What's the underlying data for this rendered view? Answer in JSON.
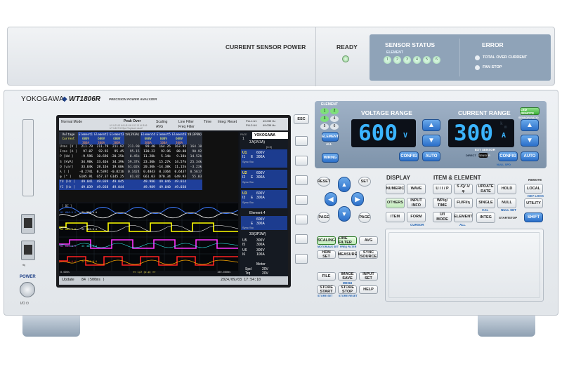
{
  "sensor_unit": {
    "current_sensor_power": "CURRENT SENSOR POWER",
    "ready": "READY",
    "sensor_status": "SENSOR STATUS",
    "element": "ELEMENT",
    "element_numbers": [
      "1",
      "2",
      "3",
      "4",
      "5",
      "6"
    ],
    "error": "ERROR",
    "total_over_current": "TOTAL OVER CURRENT",
    "fan_stop": "FAN STOP"
  },
  "branding": {
    "maker": "YOKOGAWA",
    "model": "WT1806R",
    "subtitle": "PRECISION POWER ANALYZER"
  },
  "power": {
    "label": "POWER"
  },
  "screen": {
    "mode": "Normal Mode",
    "peak_over": "Peak Over",
    "peak_rows": [
      "U1 U2 U3 U4 U5 U6 I1 I2 I3 I4 I5 I6",
      "U7 U8 I7 I8 Spd Trq Aux1 Aux2"
    ],
    "scaling": "Scaling",
    "avg": "AVG",
    "line_filter": "Line Filter",
    "freq_filter": "Freq Filter",
    "time": "Time",
    "integ": "Integ: Reset",
    "pll1": "PLL1:U1",
    "pll1_val": "49.039 Hz",
    "pll2": "PLL2:U4",
    "pll2_val": "49.039 Hz",
    "page": "PAGE",
    "page_num": "1",
    "brand": "YOKOGAWA",
    "header_row1": [
      "Voltage",
      "Element1",
      "Element2",
      "Element3",
      "ΣA(3V3A)",
      "Element4",
      "Element5",
      "Element6",
      "ΣB(3P3W)"
    ],
    "header_row2": [
      "Current",
      "600V",
      "600V",
      "600V",
      "",
      "600V",
      "600V",
      "600V",
      ""
    ],
    "header_row3": [
      "",
      "300A",
      "300A",
      "300A",
      "",
      "300A",
      "100A",
      "300A",
      ""
    ],
    "rows": [
      {
        "label": "Urms [V ]",
        "vals": [
          "211.79",
          "211.79",
          "211.92",
          "211.90",
          "99.40",
          "164.26",
          "163.95",
          "164.10"
        ]
      },
      {
        "label": "Irms [A ]",
        "vals": [
          "97.07",
          "92.93",
          "95.45",
          "95.15",
          "130.22",
          "92.96",
          "88.88",
          "90.92"
        ]
      },
      {
        "label": "P    [kW ]",
        "vals": [
          "-9.596",
          "10.696",
          "-20.25k",
          "0.45k",
          "11.28k",
          "5.14k",
          "9.38k",
          "14.52k"
        ]
      },
      {
        "label": "S    [kVA]",
        "vals": [
          "34.98k",
          "33.46k",
          "34.39k",
          "59.37k",
          "23.30k",
          "15.27k",
          "14.57k",
          "25.34k"
        ]
      },
      {
        "label": "Q    [var]",
        "vals": [
          "33.64k",
          "28.16k",
          "19.60k",
          "61.02k",
          "20.30k",
          "-14.38k",
          "11.15k",
          "-3.23k"
        ]
      },
      {
        "label": "λ    [  ]",
        "vals": [
          "-0.2741",
          "0.5392",
          "-0.8216",
          "0.1424",
          "0.4843",
          "0.3364",
          "0.6437",
          "0.5617"
        ]
      },
      {
        "label": "φ    [°  ]",
        "vals": [
          "G105.91",
          "G57.37",
          "G145.25",
          "81.82",
          "G61.03",
          "D70.34",
          "G49.93",
          "55.83"
        ]
      },
      {
        "label": "fU   [Hz ]",
        "vals": [
          "49.041",
          "49.039",
          "49.045",
          "",
          "49.986",
          "49.046",
          "49.014",
          ""
        ]
      },
      {
        "label": "fI   [Hz ]",
        "vals": [
          "49.039",
          "49.038",
          "49.044",
          "",
          "49.989",
          "49.040",
          "49.038",
          ""
        ]
      }
    ],
    "wave_scale_top": "[  DC  ]",
    "wave_labels": [
      {
        "t": "U1",
        "v": "600.0 V"
      },
      {
        "t": "I1",
        "v": "300.0 A"
      },
      {
        "t": "U2",
        "v": "600.0 V"
      },
      {
        "t": "I2",
        "v": "300.0 A"
      },
      {
        "t": "U3",
        "v": "600.0 V"
      },
      {
        "t": "I3",
        "v": "300.0 A"
      },
      {
        "t": "U4",
        "v": "600.0 V"
      },
      {
        "t": "I4",
        "v": "300.0 A"
      }
    ],
    "time_start": "0.000s",
    "time_end": "100.000ms",
    "time_div": "<< 1/2 (p-p) >>",
    "update": "Update",
    "update_count": "84 (500ms )",
    "datetime": "2024/09/03 17:54:10",
    "side": {
      "sigA": "ΣA(3V3A)",
      "sigA_sub": "[3:3]",
      "u1": "U1",
      "u1v": "600V",
      "i1": "I1",
      "i1v": "300A",
      "e1": "E",
      "u2": "U2",
      "u2v": "600V",
      "i2": "I2",
      "i2v": "300A",
      "u3": "U3",
      "u3v": "600V",
      "i3": "I3",
      "i3v": "300A",
      "sync": "Sync Src",
      "el4": "Element 4",
      "u4v": "600V",
      "i4v": "300A",
      "sigB": "ΣB(3P3W)",
      "u5": "U5",
      "u5v": "300V",
      "i5": "I5",
      "i5v": "300A",
      "u6": "U6",
      "u6v": "300V",
      "i6": "I6",
      "i6v": "100A",
      "motor": "Motor",
      "spd": "Spd",
      "spdv": "20V",
      "trq": "Trq",
      "trqv": "20V"
    }
  },
  "esc": "ESC",
  "range": {
    "element": "ELEMENT",
    "element_nums": [
      "1",
      "2",
      "3",
      "4",
      "5",
      "6"
    ],
    "element_btn": "ELEMENT",
    "all": "ALL",
    "wiring": "WIRING",
    "voltage_title": "VOLTAGE RANGE",
    "voltage_value": "600",
    "voltage_unit": "V",
    "current_title": "CURRENT RANGE",
    "current_value": "300",
    "current_unit_k": "k",
    "current_unit_m": "m",
    "current_unit": "A",
    "config": "CONFIG",
    "auto": "AUTO",
    "ext_sensor": "EXT SENSOR",
    "direct": "DIRECT",
    "sensor": "SENSOR",
    "null_spd": "NULL SPD",
    "measure": "MEASURE",
    "remote_btn": "LED REMOTE",
    "sensor_ratio": "SENSOR RATIO"
  },
  "nav": {
    "reset": "RESET",
    "set": "SET",
    "page": "PAGE"
  },
  "display": {
    "title": "DISPLAY",
    "numeric": "NUMERIC",
    "wave": "WAVE",
    "others": "OTHERS",
    "input_info": "INPUT INFO",
    "item": "ITEM",
    "form": "FORM",
    "cursor": "CURSOR"
  },
  "item_element": {
    "title": "ITEM & ELEMENT",
    "u_i_p": "U / I / P",
    "s_q_l": "S /Q/ λ/ φ",
    "wp_time": "WP/q/ TIME",
    "fu_fi": "FU/FI/η",
    "u_i_mode": "U/I MODE",
    "element": "ELEMENT",
    "all": "ALL"
  },
  "integ": {
    "update_rate": "UPDATE RATE",
    "hold": "HOLD",
    "single": "SINGLE",
    "null": "NULL",
    "cal": "CAL",
    "null_set": "NULL SET",
    "integ": "INTEG",
    "start": "START",
    "stop": "STOP"
  },
  "remote": {
    "remote": "REMOTE",
    "local": "LOCAL",
    "key_lock": "KEY LOCK",
    "utility": "UTILITY",
    "shift": "SHIFT"
  },
  "lower": {
    "scaling": "SCALING",
    "line_filter": "LINE FILTER",
    "avg": "AVG",
    "motor_aux_set": "MOTOR/AUX SET",
    "freq_filter": "FREQ FILTER",
    "harm_set": "HRM SET",
    "measure": "MEASURE",
    "sync_source": "SYNC SOURCE",
    "file": "FILE",
    "image_save": "IMAGE SAVE",
    "input_set": "INPUT SET",
    "menu": "MENU",
    "store_start": "STORE START",
    "store_stop": "STORE STOP",
    "help": "HELP",
    "store_set": "STORE SET",
    "store_reset": "STORE RESET"
  }
}
